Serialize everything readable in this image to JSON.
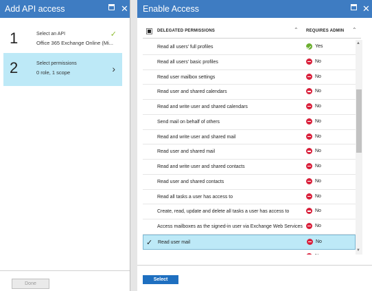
{
  "left_blade": {
    "title": "Add API access",
    "steps": [
      {
        "number": "1",
        "title": "Select an API",
        "subtitle": "Office 365 Exchange Online (Mi...",
        "done": true
      },
      {
        "number": "2",
        "title": "Select permissions",
        "subtitle": "0 role, 1 scope",
        "done": false
      }
    ],
    "done_label": "Done"
  },
  "right_blade": {
    "title": "Enable Access",
    "table": {
      "col_permissions": "DELEGATED PERMISSIONS",
      "col_admin": "REQUIRES ADMIN",
      "rows": [
        {
          "name": "Read all users' full profiles",
          "admin": "Yes"
        },
        {
          "name": "Read all users' basic profiles",
          "admin": "No"
        },
        {
          "name": "Read user mailbox settings",
          "admin": "No"
        },
        {
          "name": "Read user and shared calendars",
          "admin": "No"
        },
        {
          "name": "Read and write user and shared calendars",
          "admin": "No"
        },
        {
          "name": "Send mail on behalf of others",
          "admin": "No"
        },
        {
          "name": "Read and write user and shared mail",
          "admin": "No"
        },
        {
          "name": "Read user and shared mail",
          "admin": "No"
        },
        {
          "name": "Read and write user and shared contacts",
          "admin": "No"
        },
        {
          "name": "Read user and shared contacts",
          "admin": "No"
        },
        {
          "name": "Read all tasks a user has access to",
          "admin": "No"
        },
        {
          "name": "Create, read, update and delete all tasks a user has access to",
          "admin": "No"
        },
        {
          "name": "Access mailboxes as the signed-in user via Exchange Web Services",
          "admin": "No"
        },
        {
          "name": "Read user mail",
          "admin": "No"
        },
        {
          "name": "Read and write user mail",
          "admin": "No"
        }
      ]
    },
    "select_label": "Select"
  },
  "colors": {
    "header": "#3e7cc2",
    "selected": "#bde9f7",
    "yes": "#6bae2f",
    "no": "#d9203b",
    "button": "#1e6fc0"
  }
}
